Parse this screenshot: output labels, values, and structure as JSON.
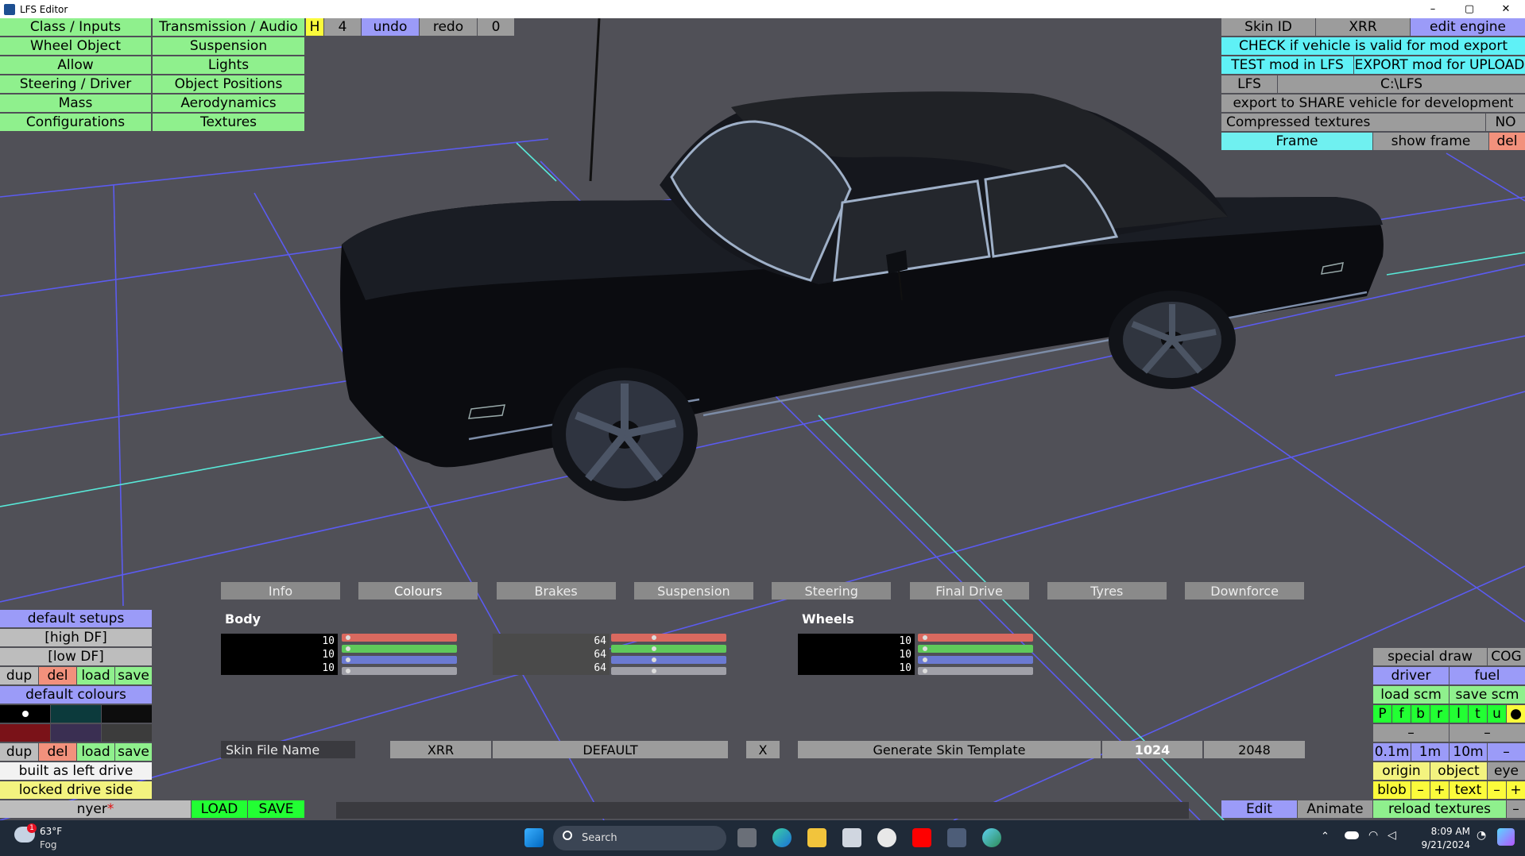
{
  "window": {
    "title": "LFS Editor",
    "minimize": "–",
    "maximize": "▢",
    "close": "✕"
  },
  "menu_left": {
    "col1": [
      "Class / Inputs",
      "Wheel Object",
      "Allow",
      "Steering / Driver",
      "Mass",
      "Configurations"
    ],
    "col2": [
      "Transmission / Audio",
      "Suspension",
      "Lights",
      "Object Positions",
      "Aerodynamics",
      "Textures"
    ]
  },
  "top_controls": {
    "h": "H",
    "num": "4",
    "undo": "undo",
    "redo": "redo",
    "zero": "0"
  },
  "right_panel": {
    "skin_id": "Skin ID",
    "xrr": "XRR",
    "edit_engine": "edit engine",
    "check": "CHECK if vehicle is valid for mod export",
    "test": "TEST mod in LFS",
    "export": "EXPORT mod for UPLOAD",
    "lfs_label": "LFS",
    "lfs_path": "C:\\LFS",
    "share": "export to SHARE vehicle for development",
    "compressed_label": "Compressed textures",
    "compressed_value": "NO",
    "frame": "Frame",
    "show_frame": "show frame",
    "del": "del"
  },
  "bottom_tabs": [
    "Info",
    "Colours",
    "Brakes",
    "Suspension",
    "Steering",
    "Final Drive",
    "Tyres",
    "Downforce"
  ],
  "colour_panel": {
    "body_label": "Body",
    "wheels_label": "Wheels",
    "body_values": [
      "10",
      "10",
      "10"
    ],
    "mid_values": [
      "64",
      "64",
      "64"
    ],
    "wheel_values": [
      "10",
      "10",
      "10"
    ]
  },
  "skin_row": {
    "file_name": "Skin File Name",
    "xrr": "XRR",
    "default": "DEFAULT",
    "x": "X",
    "generate": "Generate Skin Template",
    "res1": "1024",
    "res2": "2048"
  },
  "left_bottom": {
    "default_setups": "default setups",
    "high_df": "[high DF]",
    "low_df": "[low DF]",
    "dup": "dup",
    "del": "del",
    "load": "load",
    "save": "save",
    "default_colours": "default colours",
    "built_as": "built as left drive",
    "locked": "locked drive side",
    "name": "nyer",
    "name_marker": "*",
    "load_btn": "LOAD",
    "save_btn": "SAVE",
    "swatch_colors": [
      "#000000",
      "#0c3a3c",
      "#0d0d0d",
      "#7a1218",
      "#3a2f52",
      "#3c3c3c"
    ]
  },
  "right_bottom": {
    "special_draw": "special draw",
    "cog": "COG",
    "driver": "driver",
    "fuel": "fuel",
    "load_scm": "load scm",
    "save_scm": "save scm",
    "letters": [
      "P",
      "f",
      "b",
      "r",
      "l",
      "t",
      "u",
      "●"
    ],
    "minus1": "–",
    "minus2": "–",
    "dist1": "0.1m",
    "dist2": "1m",
    "dist3": "10m",
    "dist_minus": "–",
    "origin": "origin",
    "object": "object",
    "eye": "eye",
    "blob": "blob",
    "blob_minus": "–",
    "blob_plus": "+",
    "text": "text",
    "text_minus": "–",
    "text_plus": "+",
    "edit": "Edit",
    "animate": "Animate",
    "reload": "reload textures",
    "reload_minus": "–"
  },
  "taskbar": {
    "weather_temp": "63°F",
    "weather_desc": "Fog",
    "weather_badge": "1",
    "search_placeholder": "Search",
    "time": "8:09 AM",
    "date": "9/21/2024"
  }
}
